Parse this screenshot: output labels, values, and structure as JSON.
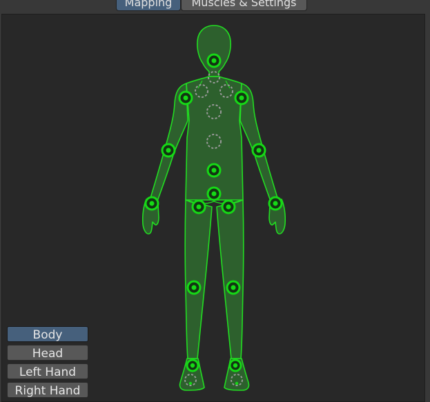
{
  "tabs": [
    {
      "label": "Mapping",
      "active": true
    },
    {
      "label": "Muscles & Settings",
      "active": false
    }
  ],
  "view_buttons": [
    {
      "label": "Body",
      "selected": true
    },
    {
      "label": "Head",
      "selected": false
    },
    {
      "label": "Left Hand",
      "selected": false
    },
    {
      "label": "Right Hand",
      "selected": false
    }
  ],
  "colors": {
    "accent_tab": "#46607c",
    "body_outline": "#22dd22",
    "body_fill": "#2e6a2e",
    "bone_mapped": "#16d916",
    "bone_unmapped": "#9a9a9a"
  }
}
